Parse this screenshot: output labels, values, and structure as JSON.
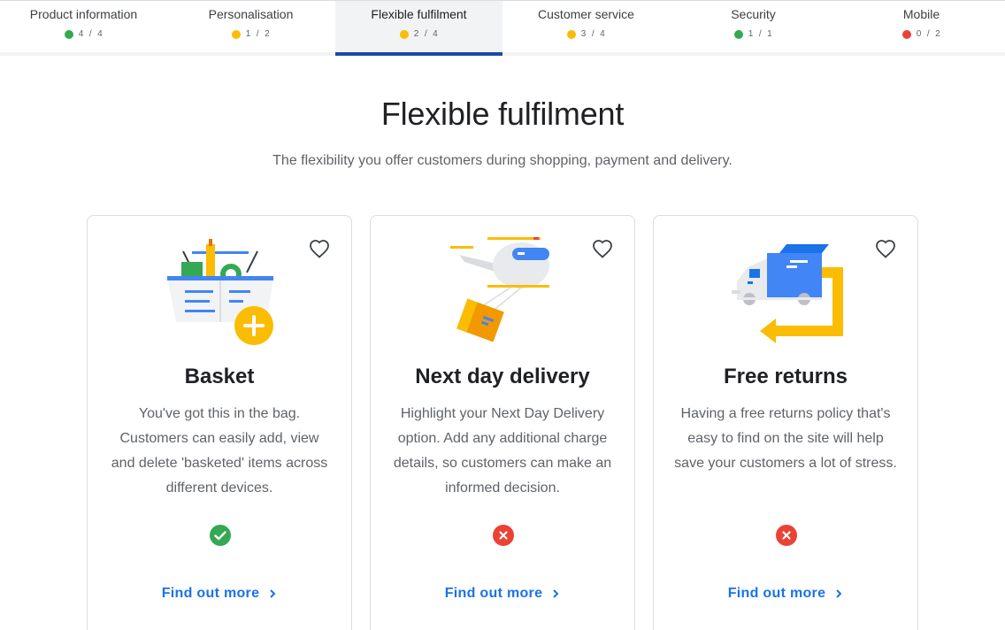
{
  "tabs": [
    {
      "label": "Product information",
      "done": "4",
      "total": "4",
      "status_color": "#34a853"
    },
    {
      "label": "Personalisation",
      "done": "1",
      "total": "2",
      "status_color": "#fbbc04"
    },
    {
      "label": "Flexible fulfilment",
      "done": "2",
      "total": "4",
      "status_color": "#fbbc04",
      "active": true
    },
    {
      "label": "Customer service",
      "done": "3",
      "total": "4",
      "status_color": "#fbbc04"
    },
    {
      "label": "Security",
      "done": "1",
      "total": "1",
      "status_color": "#34a853"
    },
    {
      "label": "Mobile",
      "done": "0",
      "total": "2",
      "status_color": "#ea4335"
    }
  ],
  "progress_separator": "/",
  "page": {
    "title": "Flexible fulfilment",
    "subtitle": "The flexibility you offer customers during shopping, payment and delivery."
  },
  "cards": [
    {
      "title": "Basket",
      "description": "You've got this in the bag. Customers can easily add, view and delete 'basketed' items across different devices.",
      "status": "complete",
      "illustration_icon": "basket-icon",
      "link": "Find out more"
    },
    {
      "title": "Next day delivery",
      "description": "Highlight your Next Day Delivery option. Add any additional charge details, so customers can make an informed decision.",
      "status": "incomplete",
      "illustration_icon": "drone-delivery-icon",
      "link": "Find out more"
    },
    {
      "title": "Free returns",
      "description": "Having a free returns policy that's easy to find on the site will help save your customers a lot of stress.",
      "status": "incomplete",
      "illustration_icon": "returns-truck-icon",
      "link": "Find out more"
    }
  ],
  "colors": {
    "accent_blue": "#1a73e8",
    "active_tab_underline": "#1a4aa8",
    "green": "#34a853",
    "yellow": "#fbbc04",
    "red": "#ea4335"
  }
}
